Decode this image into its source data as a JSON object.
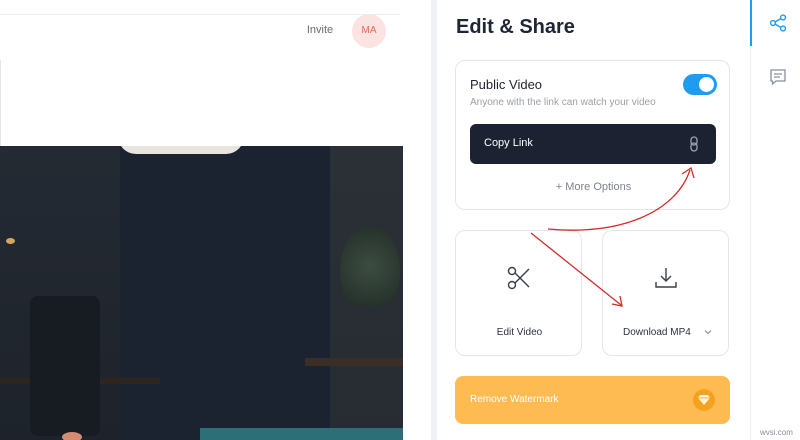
{
  "topbar": {
    "invite_label": "Invite",
    "avatar_initials": "MA"
  },
  "panel": {
    "title": "Edit & Share",
    "public_video": {
      "title": "Public Video",
      "description": "Anyone with the link can watch your video",
      "enabled": true
    },
    "copy_link_label": "Copy Link",
    "more_options_label": "+ More Options",
    "tiles": [
      {
        "label": "Edit Video",
        "icon": "scissors-icon"
      },
      {
        "label": "Download MP4",
        "icon": "download-icon"
      }
    ],
    "remove_watermark_label": "Remove Watermark"
  },
  "rail": {
    "items": [
      {
        "icon": "share-icon",
        "active": true
      },
      {
        "icon": "comment-icon",
        "active": false
      }
    ]
  },
  "watermark_text": "wvsi.com",
  "colors": {
    "accent": "#1f9bf0",
    "copy_link_bg": "#1d2233",
    "watermark_bg": "#fdbb52",
    "annotation_arrow": "#d62a2a"
  }
}
